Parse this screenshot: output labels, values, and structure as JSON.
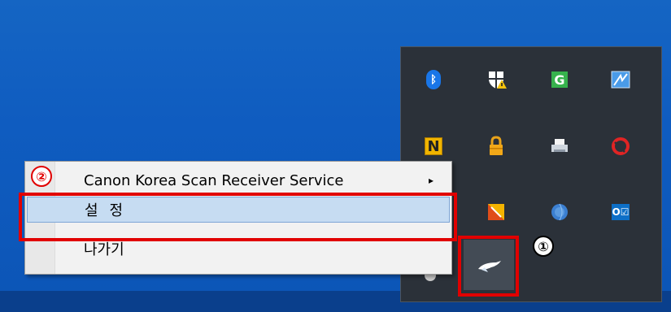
{
  "context_menu": {
    "items": [
      {
        "label": "Canon Korea Scan Receiver Service",
        "submenu_arrow": "▸"
      },
      {
        "label": "설정",
        "highlighted": true
      },
      {
        "label": "나가기"
      }
    ]
  },
  "tray": {
    "icons": [
      "bluetooth-icon",
      "security-shield-warning-icon",
      "green-g-icon",
      "blue-app-icon",
      "n-app-icon",
      "padlock-icon",
      "printer-icon",
      "red-ring-icon",
      "yellow-app-icon",
      "blue-globe-icon",
      "outlook-icon",
      "scanner-receiver-icon"
    ]
  },
  "annotations": {
    "step1": "①",
    "step2": "②"
  },
  "colors": {
    "desktop": "#1565c3",
    "tray_bg": "#2b3139",
    "highlight": "#e10000",
    "menu_selected": "#c6dcf2"
  }
}
